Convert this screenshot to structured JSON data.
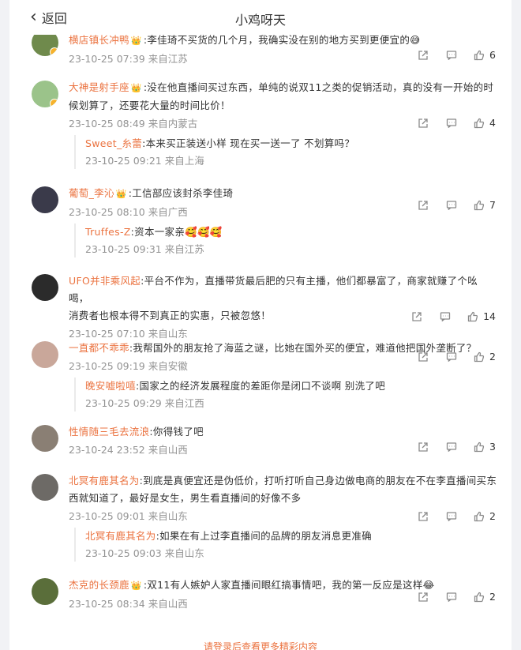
{
  "header": {
    "back_label": "返回",
    "title": "小鸡呀天"
  },
  "comments": [
    {
      "user": "横店镇长冲鸭",
      "text": ":李佳琦不买货的几个月，我确实没在别的地方买到更便宜的",
      "emoji": "😅",
      "time": "23-10-25 07:39",
      "location": "来自江苏",
      "likes": "6",
      "avatar_color": "#6f8a4c"
    },
    {
      "user": "大神是射手座",
      "text_lines": [
        ":没在他直播间买过东西，单纯的说双11之类的促销活动，真的没有一开始的时",
        "候划算了，还要花大量的时间比价！"
      ],
      "time": "23-10-25 08:49",
      "location": "来自内蒙古",
      "likes": "4",
      "avatar_color": "#9bc38a",
      "replies": [
        {
          "user": "Sweet_糸蕾",
          "text": ":本来买正装送小样 现在买一送一了 不划算吗？",
          "time": "23-10-25 09:21",
          "location": "来自上海"
        }
      ]
    },
    {
      "user": "葡萄_李沁",
      "text": ":工信部应该封杀李佳琦",
      "time": "23-10-25 08:10",
      "location": "来自广西",
      "likes": "7",
      "avatar_color": "#3a3a4a",
      "replies": [
        {
          "user": "Truffes-Z",
          "text": ":资本一家亲",
          "emoji": "🥰🥰🥰",
          "time": "23-10-25 09:31",
          "location": "来自江苏"
        }
      ]
    },
    {
      "user": "UFO并非乘风起",
      "text_lines": [
        ":平台不作为，直播带货最后肥的只有主播，他们都暴富了，商家就赚了个吆喝，",
        "消费者也根本得不到真正的实惠，只被忽悠！"
      ],
      "time": "23-10-25 07:10",
      "location": "来自山东",
      "likes": "14",
      "avatar_color": "#2b2b2b"
    },
    {
      "user": "一直都不乖乖",
      "text": ":我帮国外的朋友抢了海蓝之谜，比她在国外买的便宜，难道他把国外垄断了？",
      "time": "23-10-25 09:19",
      "location": "来自安徽",
      "likes": "2",
      "avatar_color": "#c9a79a",
      "replies": [
        {
          "user": "晚安嘘啦嘻",
          "text": ":国家之的经济发展程度的差距你是闭口不谈啊 别洗了吧",
          "time": "23-10-25 09:29",
          "location": "来自江西"
        }
      ]
    },
    {
      "user": "性情随三毛去流浪",
      "text": ":你得钱了吧",
      "time": "23-10-24 23:52",
      "location": "来自山西",
      "likes": "3",
      "avatar_color": "#8a7f74"
    },
    {
      "user": "北冥有鹿其名为",
      "text_lines": [
        ":到底是真便宜还是伪低价，打听打听自己身边做电商的朋友在不在李直播间买东",
        "西就知道了，最好是女生，男生看直播间的好像不多"
      ],
      "time": "23-10-25 09:01",
      "location": "来自山东",
      "likes": "2",
      "avatar_color": "#6d6a66",
      "replies": [
        {
          "user": "北冥有鹿其名为",
          "text": ":如果在有上过李直播间的品牌的朋友消息更准确",
          "time": "23-10-25 09:03",
          "location": "来自山东"
        }
      ]
    },
    {
      "user": "杰克的长颈鹿",
      "text": ":双11有人嫉妒人家直播间眼红搞事情吧，我的第一反应是这样",
      "emoji": "😂",
      "time": "23-10-25 08:34",
      "location": "来自山西",
      "likes": "2",
      "avatar_color": "#5a6e3a"
    }
  ],
  "footer": {
    "login_prompt": "请登录后查看更多精彩内容"
  },
  "colors": {
    "username": "#eb7340",
    "meta": "#939393",
    "crown": "#f39c12"
  }
}
